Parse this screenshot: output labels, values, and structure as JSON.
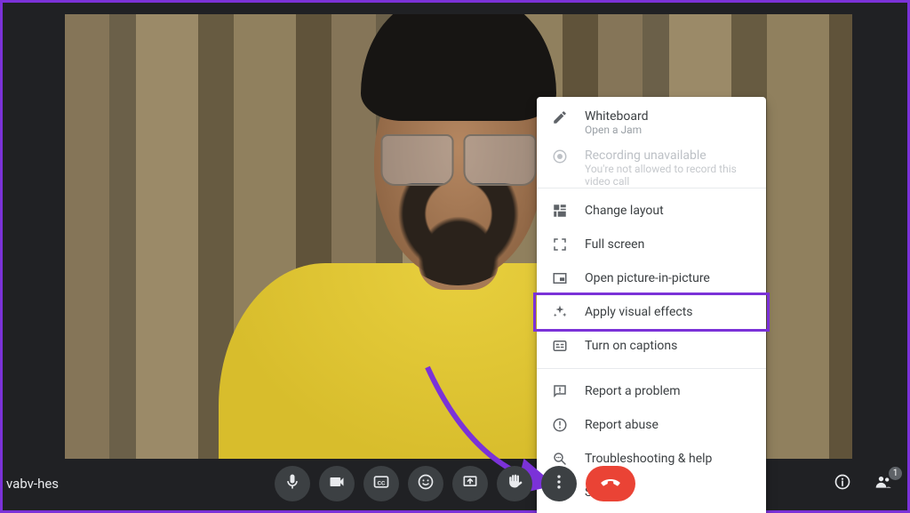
{
  "meeting_id": "vabv-hes",
  "participants_badge": "1",
  "menu": {
    "whiteboard": {
      "title": "Whiteboard",
      "sub": "Open a Jam"
    },
    "recording": {
      "title": "Recording unavailable",
      "sub": "You're not allowed to record this video call"
    },
    "change_layout": "Change layout",
    "full_screen": "Full screen",
    "pip": "Open picture-in-picture",
    "visual_effects": "Apply visual effects",
    "captions": "Turn on captions",
    "report_problem": "Report a problem",
    "report_abuse": "Report abuse",
    "troubleshoot": "Troubleshooting & help",
    "settings": "Settings"
  }
}
